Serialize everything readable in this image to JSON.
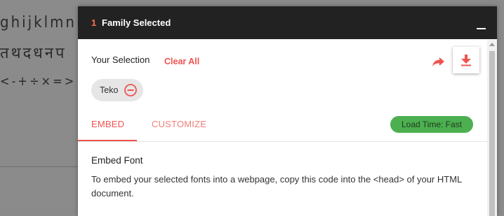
{
  "background": {
    "line1": "ghijklmn",
    "line2": "तथदधनप",
    "line3": "<-+÷×=>"
  },
  "header": {
    "count": "1",
    "title": "Family Selected"
  },
  "selection": {
    "label": "Your Selection",
    "clear_all": "Clear All",
    "chips": [
      {
        "name": "Teko"
      }
    ]
  },
  "tabs": [
    {
      "label": "EMBED",
      "active": true
    },
    {
      "label": "CUSTOMIZE",
      "active": false
    }
  ],
  "load_time": "Load Time: Fast",
  "embed": {
    "title": "Embed Font",
    "description": "To embed your selected fonts into a webpage, copy this code into the <head> of your HTML document."
  },
  "colors": {
    "accent": "#ef5350",
    "header_bg": "#222222",
    "badge_green": "#4caf50"
  },
  "icons": {
    "share": "share-arrow-icon",
    "download": "download-icon",
    "remove": "remove-circle-icon",
    "minimize": "minimize-icon"
  }
}
